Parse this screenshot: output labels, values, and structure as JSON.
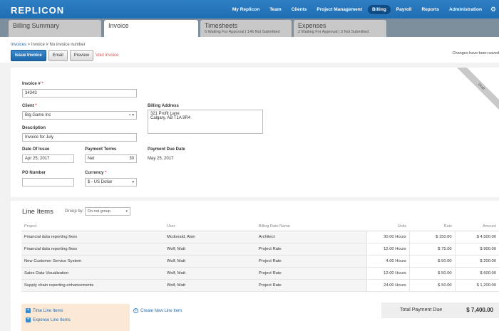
{
  "app": {
    "logo": "REPLICON",
    "nav": [
      "My Replicon",
      "Team",
      "Clients",
      "Project Management",
      "Billing",
      "Payroll",
      "Reports",
      "Administration"
    ],
    "active_nav": "Billing"
  },
  "tabs": {
    "billing_summary": "Billing Summary",
    "invoice": "Invoice",
    "timesheets": "Timesheets",
    "timesheets_sub": "5 Waiting For Approval | 146 Not Submitted",
    "expenses": "Expenses",
    "expenses_sub": "2 Waiting For Approval | 3 Not Submitted"
  },
  "breadcrumb": {
    "root": "Invoices",
    "sep": " > ",
    "current": "Invoice # No invoice number"
  },
  "actions": {
    "issue": "Issue Invoice",
    "email": "Email",
    "preview": "Preview",
    "void": "Void Invoice",
    "saved": "Changes have been saved"
  },
  "form": {
    "draft": "Draft",
    "invoice_number_label": "Invoice #",
    "invoice_number": "34343",
    "client_label": "Client",
    "client": "Big Game Inc",
    "billing_address_label": "Billing Address",
    "billing_address_line1": "321 Profit Lane",
    "billing_address_line2": "Calgary, AB T1A 9R4",
    "description_label": "Description",
    "description": "Invoice for July",
    "date_of_issue_label": "Date Of Issue",
    "date_of_issue": "Apr 25, 2017",
    "payment_terms_label": "Payment Terms",
    "payment_terms": "Net",
    "payment_terms_days": "30",
    "payment_due_label": "Payment Due Date",
    "payment_due": "May 25, 2017",
    "po_number_label": "PO Number",
    "po_number": "",
    "currency_label": "Currency",
    "currency": "$ - US Dollar"
  },
  "line_items": {
    "title": "Line Items",
    "group_by_label": "Group by:",
    "group_by": "Do not group",
    "columns": [
      "Project",
      "User",
      "Billing Rate Name",
      "Units",
      "Rate",
      "Amount"
    ],
    "rows": [
      [
        "Financial data reporting fixes",
        "Mcdonald, Alan",
        "Architect",
        "30.00 Hours",
        "$ 150.00",
        "$ 4,500.00"
      ],
      [
        "Financial data reporting fixes",
        "Wolf, Matt",
        "Project Rate",
        "12.00 Hours",
        "$ 75.00",
        "$ 900.00"
      ],
      [
        "New Customer Service System",
        "Wolf, Matt",
        "Project Rate",
        "4.00 Hours",
        "$ 50.00",
        "$ 200.00"
      ],
      [
        "Sales Data Visualization",
        "Wolf, Matt",
        "Project Rate",
        "12.00 Hours",
        "$ 50.00",
        "$ 600.00"
      ],
      [
        "Supply chain reporting enhancements",
        "Wolf, Matt",
        "Project Rate",
        "24.00 Hours",
        "$ 50.00",
        "$ 1,200.00"
      ]
    ],
    "time_line_items": "Time Line Items",
    "expense_line_items": "Expense Line Items",
    "create_new": "Create New Line Item",
    "total_label": "Total Payment Due",
    "total_value": "$ 7,400.00"
  }
}
